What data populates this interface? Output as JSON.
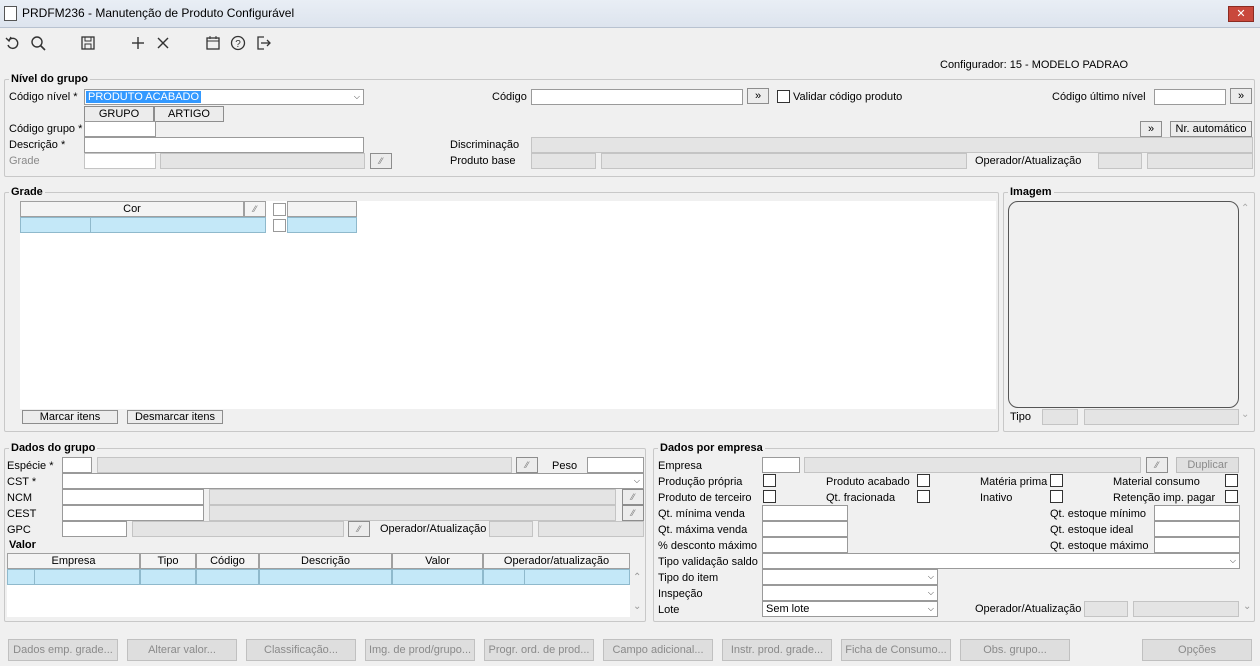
{
  "window": {
    "title": "PRDFM236 - Manutenção de Produto Configurável",
    "close": "✕"
  },
  "configurador": "Configurador: 15 - MODELO PADRAO",
  "nivel": {
    "legend": "Nível do grupo",
    "codigo_nivel_label": "Código nível *",
    "codigo_nivel_value": "PRODUTO ACABADO",
    "tab_grupo": "GRUPO",
    "tab_artigo": "ARTIGO",
    "codigo_label": "Código",
    "validar_label": "Validar código produto",
    "codigo_ultimo_label": "Código último nível",
    "codigo_grupo_label": "Código grupo *",
    "nr_automatico": "Nr. automático",
    "descricao_label": "Descrição *",
    "discriminacao_label": "Discriminação",
    "grade_label": "Grade",
    "produto_base_label": "Produto base",
    "operador_label": "Operador/Atualização",
    "arrow": "»"
  },
  "grade": {
    "legend": "Grade",
    "col_cor": "Cor",
    "marcar": "Marcar itens",
    "desmarcar": "Desmarcar itens"
  },
  "imagem": {
    "legend": "Imagem",
    "tipo_label": "Tipo"
  },
  "dados_grupo": {
    "legend": "Dados do grupo",
    "especie": "Espécie *",
    "peso": "Peso",
    "cst": "CST *",
    "ncm": "NCM",
    "cest": "CEST",
    "gpc": "GPC",
    "operador": "Operador/Atualização"
  },
  "valor": {
    "legend": "Valor",
    "columns": [
      "Empresa",
      "Tipo",
      "Código",
      "Descrição",
      "Valor",
      "Operador/atualização"
    ]
  },
  "dados_empresa": {
    "legend": "Dados por empresa",
    "empresa": "Empresa",
    "duplicar": "Duplicar",
    "producao_propria": "Produção própria",
    "produto_acabado": "Produto acabado",
    "materia_prima": "Matéria prima",
    "material_consumo": "Material consumo",
    "produto_terceiro": "Produto de terceiro",
    "qt_fracionada": "Qt. fracionada",
    "inativo": "Inativo",
    "retencao": "Retenção imp. pagar",
    "qt_min_venda": "Qt. mínima venda",
    "qt_max_venda": "Qt. máxima venda",
    "desconto": "% desconto máximo",
    "qt_est_min": "Qt. estoque mínimo",
    "qt_est_ideal": "Qt. estoque ideal",
    "qt_est_max": "Qt. estoque máximo",
    "tipo_validacao": "Tipo validação saldo",
    "tipo_item": "Tipo do item",
    "inspecao": "Inspeção",
    "lote": "Lote",
    "lote_value": "Sem lote",
    "operador": "Operador/Atualização"
  },
  "bottom_buttons": [
    "Dados emp. grade...",
    "Alterar valor...",
    "Classificação...",
    "Img. de prod/grupo...",
    "Progr. ord. de prod...",
    "Campo adicional...",
    "Instr. prod. grade...",
    "Ficha de Consumo...",
    "Obs. grupo...",
    "Opções"
  ]
}
